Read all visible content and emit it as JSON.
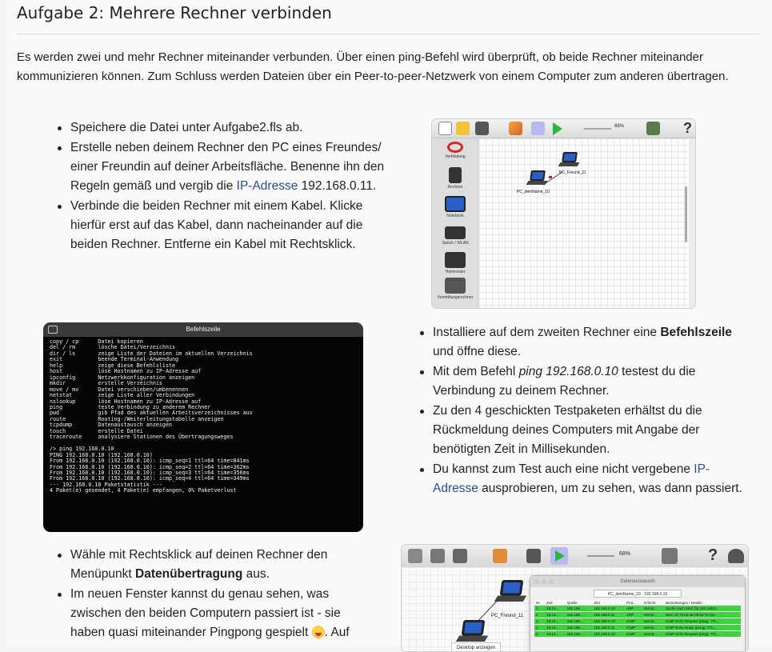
{
  "heading": "Aufgabe 2: Mehrere Rechner verbinden",
  "intro": "Es werden zwei und mehr Rechner miteinander verbunden. Über einen ping-Befehl wird überprüft, ob beide Rechner miteinander kommunizieren können. Zum Schluss werden Dateien über ein Peer-to-peer-Netzwerk von einem Computer zum anderen übertragen.",
  "list1": {
    "item1": "Speichere die Datei unter Aufgabe2.fls ab.",
    "item2_pre": "Erstelle neben deinem Rechner den PC eines Freundes/ einer Freundin auf deiner Arbeitsfläche. Benenne ihn den Regeln gemäß und vergib die ",
    "item2_link": "IP-Adresse",
    "item2_post": " 192.168.0.11.",
    "item3": "Verbinde die beiden Rechner mit einem Kabel. Klicke hierfür erst auf das Kabel, dann nacheinander auf die beiden Rechner. Entferne ein Kabel mit Rechtsklick."
  },
  "list2": {
    "item1_pre": "Installiere auf dem zweiten Rechner eine ",
    "item1_bold": "Befehlszeile",
    "item1_post": " und öffne diese.",
    "item2_pre": "Mit dem Befehl ",
    "item2_italic": "ping 192.168.0.10",
    "item2_post": " testest du die Verbindung zu deinem Rechner.",
    "item3": "Zu den 4 geschickten Testpaketen erhältst du die Rückmeldung deines Computers mit Angabe der benötigten Zeit in Millisekunden.",
    "item4_pre": "Du kannst zum Test auch eine nicht vergebene ",
    "item4_link": "IP-Adresse",
    "item4_post": " ausprobieren, um zu sehen, was dann passiert."
  },
  "list3": {
    "item1_pre": "Wähle mit Rechtsklick auf deinen Rechner den Menüpunkt ",
    "item1_bold": "Datenübertragung",
    "item1_post": " aus.",
    "item2": "Im neuen Fenster kannst du genau sehen, was zwischen den beiden Computern passiert ist - sie haben quasi miteinander Pingpong gespielt",
    "item2_tail": ". Auf"
  },
  "filius1": {
    "zoom": "68%",
    "palette": [
      "Verbindung",
      "Rechner",
      "Notebook",
      "Switch / WLAN",
      "Heimrouter",
      "Vermittlungsrechner"
    ],
    "node_a": "PC_Freund_11",
    "node_b": "PC_deinName_10"
  },
  "terminal": {
    "title": "Befehlszeile",
    "lines": "copy / cp      Datei kopieren\ndel / rm       lösche Datei/Verzeichnis\ndir / ls       zeige Liste der Dateien im aktuellen Verzeichnis\nexit           beende Terminal-Anwendung\nhelp           zeige diese Befehlsliste\nhost           löse Hostnamen zu IP-Adresse auf\nipconfig       Netzwerkkonfiguration anzeigen\nmkdir          erstelle Verzeichnis\nmove / mv      Datei verschieben/umbenennen\nnetstat        zeige Liste aller Verbindungen\nnslookup       löse Hostnamen zu IP-Adresse auf\nping           teste Verbindung zu anderem Rechner\npwd            gib Pfad des aktuellen Arbeitsverzeichnisses aus\nroute          Routing-/Weiterleitungstabelle anzeigen\ntcpdump        Datenaustausch anzeigen\ntouch          erstelle Datei\ntraceroute     analysiere Stationen des Übertragungsweges\n\n/> ping 192.168.0.10\nPING 192.168.0.10 (192.168.0.10)\nFrom 192.168.0.10 (192.168.0.10): icmp_seq=1 ttl=64 time=841ms\nFrom 192.168.0.10 (192.168.0.10): icmp_seq=2 ttl=64 time=362ms\nFrom 192.168.0.10 (192.168.0.10): icmp_seq=3 ttl=64 time=356ms\nFrom 192.168.0.10 (192.168.0.10): icmp_seq=4 ttl=64 time=349ms\n--- 192.168.0.10 Paketstatistik ---\n4 Paket(e) gesendet, 4 Paket(e) empfangen, 0% Paketverlust"
  },
  "filius2": {
    "zoom": "68%",
    "node": "PC_Freund_11",
    "context_item": "Desktop anzeigen",
    "dialog_title": "Datenaustausch",
    "dialog_tab": "PC_deinName_10 - 192.168.0.10",
    "columns": [
      "Nr.",
      "Zeit",
      "Quelle",
      "Ziel",
      "Prot...",
      "Schicht",
      "Bemerkungen / Details"
    ],
    "rows": [
      [
        "1",
        "16:13...",
        "192.168....",
        "192.168.0.10",
        "ARP",
        "Vermit...",
        "Suche nach MAC für 192.168.0..."
      ],
      [
        "2",
        "16:13...",
        "192.168....",
        "192.168.0.11",
        "ARP",
        "Vermit...",
        "MAC ist 75:03:4E:00:02:76 (ep..."
      ],
      [
        "3",
        "16:13...",
        "192.168....",
        "192.168.0.10",
        "ICMP",
        "Vermit...",
        "ICMP Echo Request (ping), TTL..."
      ],
      [
        "4",
        "16:13...",
        "192.168....",
        "192.168.0.11",
        "ICMP",
        "Vermit...",
        "ICMP Echo Reply (pong), TTL:..."
      ],
      [
        "5",
        "16:13...",
        "192.168....",
        "192.168.0.10",
        "ICMP",
        "Vermit...",
        "ICMP Echo Request (ping), TTL..."
      ]
    ]
  }
}
